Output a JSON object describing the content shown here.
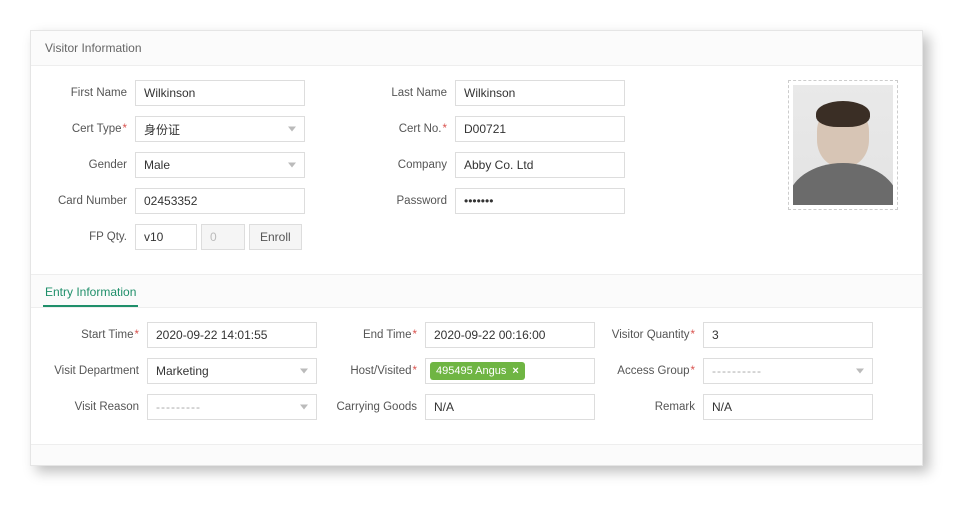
{
  "sections": {
    "visitor_title": "Visitor Information",
    "entry_title": "Entry Information"
  },
  "visitor": {
    "first_name": {
      "label": "First Name",
      "value": "Wilkinson"
    },
    "last_name": {
      "label": "Last Name",
      "value": "Wilkinson"
    },
    "cert_type": {
      "label": "Cert Type",
      "value": "身份证"
    },
    "cert_no": {
      "label": "Cert No.",
      "value": "D00721"
    },
    "gender": {
      "label": "Gender",
      "value": "Male"
    },
    "company": {
      "label": "Company",
      "value": "Abby Co. Ltd"
    },
    "card_number": {
      "label": "Card Number",
      "value": "02453352"
    },
    "password": {
      "label": "Password",
      "value": "•••••••"
    },
    "fp_qty": {
      "label": "FP Qty.",
      "device": "v10",
      "count": "0",
      "enroll": "Enroll"
    }
  },
  "entry": {
    "start_time": {
      "label": "Start Time",
      "value": "2020-09-22 14:01:55"
    },
    "end_time": {
      "label": "End Time",
      "value": "2020-09-22 00:16:00"
    },
    "visitor_qty": {
      "label": "Visitor Quantity",
      "value": "3"
    },
    "visit_dept": {
      "label": "Visit Department",
      "value": "Marketing"
    },
    "host": {
      "label": "Host/Visited",
      "chip": "495495 Angus"
    },
    "access_group": {
      "label": "Access Group",
      "value": "----------"
    },
    "visit_reason": {
      "label": "Visit Reason",
      "value": "---------"
    },
    "carrying": {
      "label": "Carrying Goods",
      "value": "N/A"
    },
    "remark": {
      "label": "Remark",
      "value": "N/A"
    }
  }
}
